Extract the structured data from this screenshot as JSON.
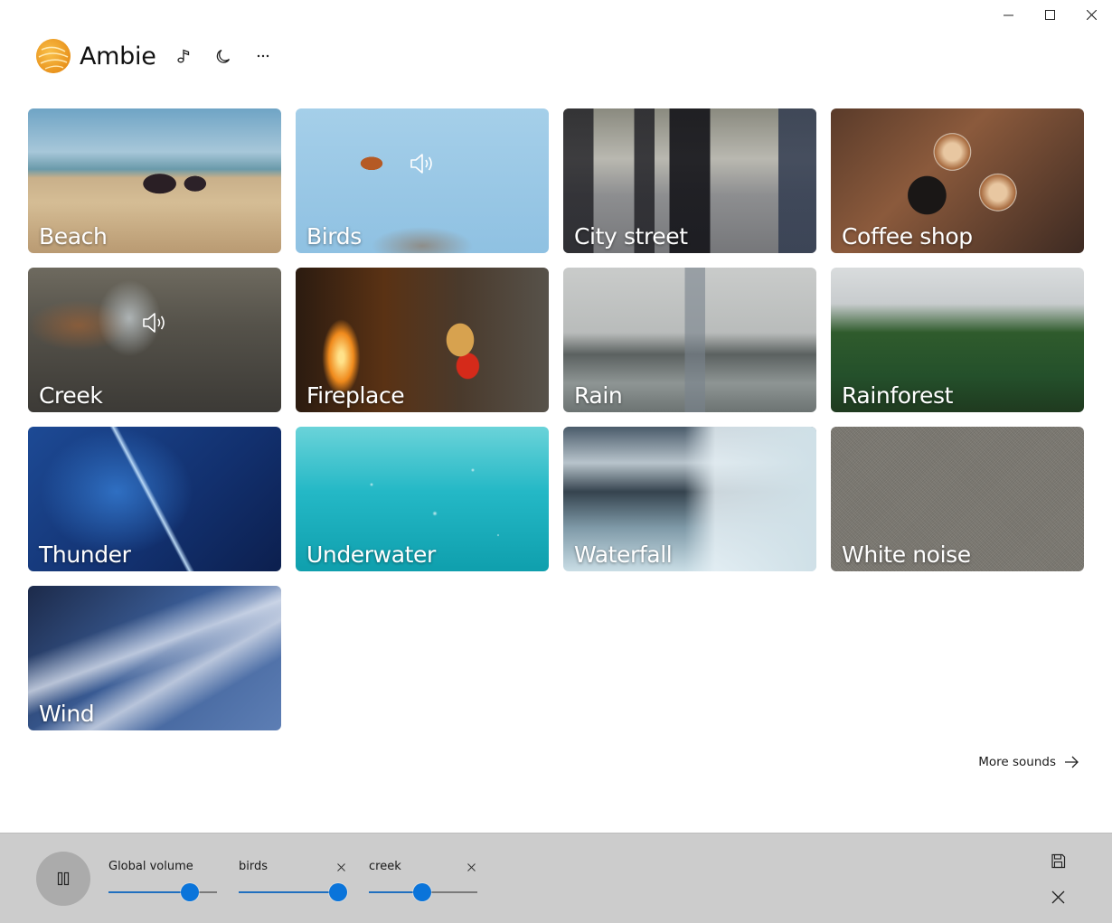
{
  "window": {
    "controls": [
      "minimize",
      "maximize",
      "close"
    ]
  },
  "header": {
    "app_title": "Ambie",
    "buttons": [
      {
        "name": "compact-mode",
        "icon": "music-note-icon"
      },
      {
        "name": "theme",
        "icon": "moon-icon"
      },
      {
        "name": "more-options",
        "icon": "ellipsis-icon",
        "label": "···"
      }
    ]
  },
  "sounds": [
    {
      "id": "beach",
      "label": "Beach",
      "playing": false,
      "bg": "bg-beach"
    },
    {
      "id": "birds",
      "label": "Birds",
      "playing": true,
      "bg": "bg-birds"
    },
    {
      "id": "city-street",
      "label": "City street",
      "playing": false,
      "bg": "bg-city"
    },
    {
      "id": "coffee-shop",
      "label": "Coffee shop",
      "playing": false,
      "bg": "bg-coffee"
    },
    {
      "id": "creek",
      "label": "Creek",
      "playing": true,
      "bg": "bg-creek"
    },
    {
      "id": "fireplace",
      "label": "Fireplace",
      "playing": false,
      "bg": "bg-fireplace"
    },
    {
      "id": "rain",
      "label": "Rain",
      "playing": false,
      "bg": "bg-rain"
    },
    {
      "id": "rainforest",
      "label": "Rainforest",
      "playing": false,
      "bg": "bg-rainforest"
    },
    {
      "id": "thunder",
      "label": "Thunder",
      "playing": false,
      "bg": "bg-thunder"
    },
    {
      "id": "underwater",
      "label": "Underwater",
      "playing": false,
      "bg": "bg-underwater"
    },
    {
      "id": "waterfall",
      "label": "Waterfall",
      "playing": false,
      "bg": "bg-waterfall"
    },
    {
      "id": "white-noise",
      "label": "White noise",
      "playing": false,
      "bg": "bg-whitenoise"
    },
    {
      "id": "wind",
      "label": "Wind",
      "playing": false,
      "bg": "bg-wind"
    }
  ],
  "more_sounds": {
    "label": "More sounds"
  },
  "player": {
    "state": "playing",
    "play_pause_icon": "pause-icon",
    "global_volume": {
      "label": "Global volume",
      "value_percent": 75
    },
    "active_sounds": [
      {
        "label": "birds",
        "value_percent": 92
      },
      {
        "label": "creek",
        "value_percent": 49
      }
    ],
    "save_icon": "save-icon",
    "clear_icon": "close-icon"
  },
  "colors": {
    "accent": "#0a74da",
    "slider_fill": "#1f6fbf",
    "player_bg": "#cccccc",
    "logo_orange": "#f0a22a"
  }
}
